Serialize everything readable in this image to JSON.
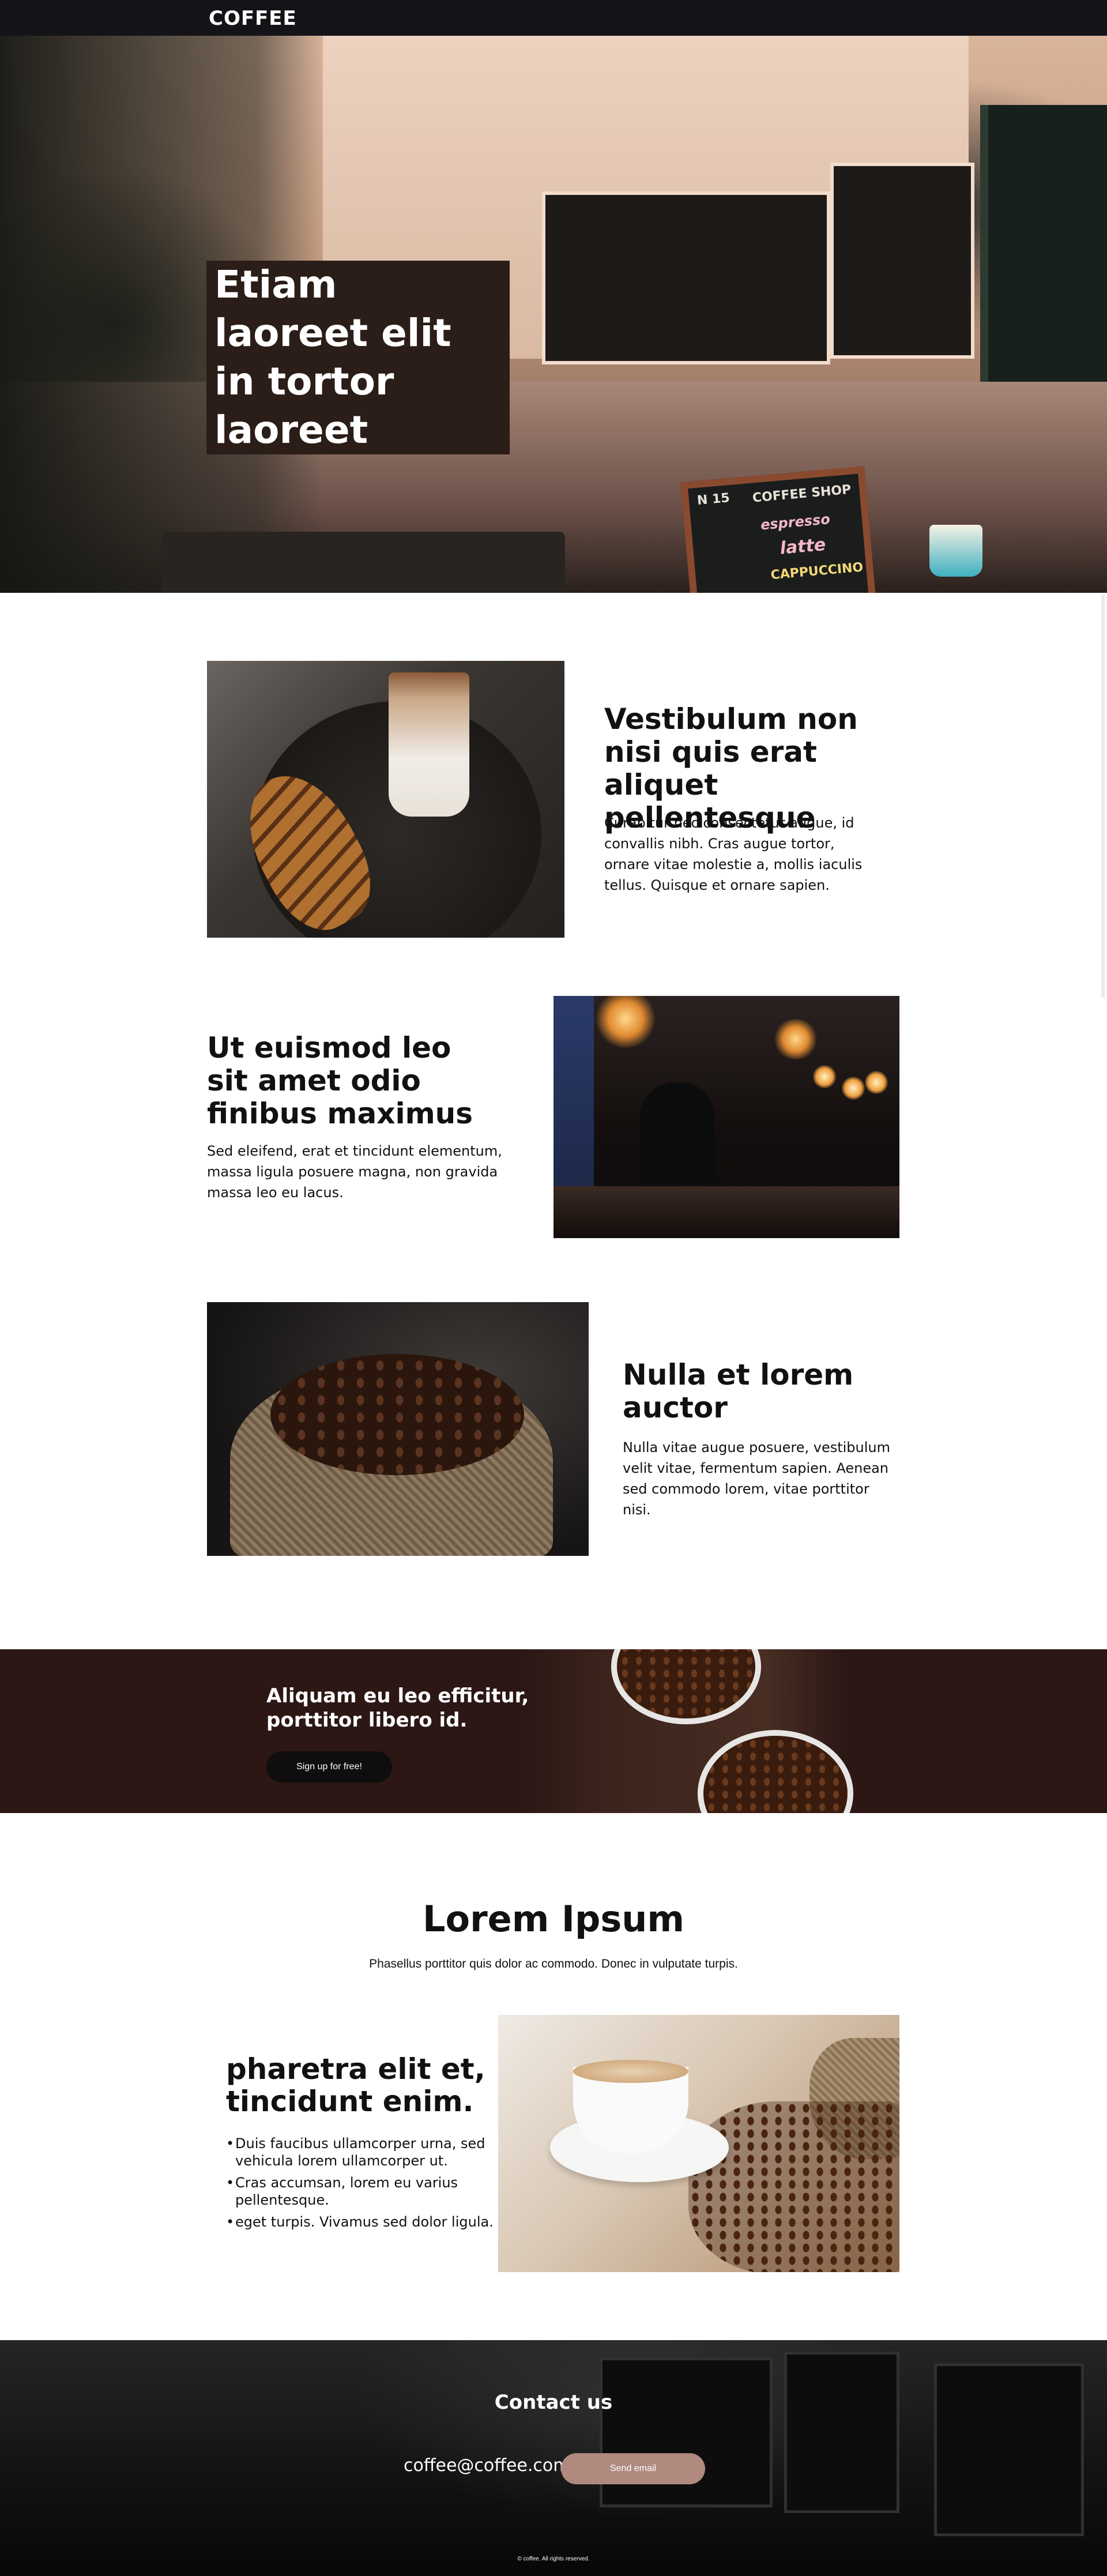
{
  "nav": {
    "brand": "COFFEE"
  },
  "hero": {
    "title_lines": [
      "Etiam laoreet elit",
      "in tortor laoreet"
    ],
    "sign": {
      "number": "N 15",
      "shop": "COFFEE SHOP",
      "items": [
        "espresso",
        "latte",
        "CAPPUCCINO"
      ]
    }
  },
  "features": [
    {
      "title": "Vestibulum non nisi quis erat aliquet pellentesque",
      "text": "Curabitur nec consectetur augue, id convallis nibh. Cras augue tortor, ornare vitae molestie a, mollis iaculis tellus. Quisque et ornare sapien.",
      "image_icon": "croissant-latte-image"
    },
    {
      "title": "Ut euismod leo sit amet odio finibus maximus",
      "text": "Sed eleifend, erat et tincidunt elementum, massa ligula posuere magna, non gravida massa leo eu lacus.",
      "image_icon": "coffee-bar-image"
    },
    {
      "title": "Nulla et lorem auctor",
      "text": "Nulla vitae augue posuere, vestibulum velit vitae, fermentum sapien. Aenean sed commodo lorem, vitae porttitor nisi.",
      "image_icon": "coffee-beans-sack-image"
    }
  ],
  "signup_band": {
    "title": "Aliquam eu leo efficitur, porttitor libero id.",
    "button_label": "Sign up for free!"
  },
  "lorem_section": {
    "title": "Lorem Ipsum",
    "subtitle": "Phasellus porttitor quis dolor ac commodo. Donec in vulputate turpis.",
    "subheading": "pharetra elit et, tincidunt enim.",
    "bullets": [
      "Duis faucibus ullamcorper urna, sed vehicula lorem ullamcorper ut.",
      "Cras accumsan, lorem eu varius pellentesque.",
      "eget turpis. Vivamus sed dolor ligula."
    ]
  },
  "contact": {
    "title": "Contact us",
    "email": "coffee@coffee.com",
    "button_label": "Send email",
    "copyright": "© coffee. All rights reserved."
  },
  "colors": {
    "nav_bg": "#141418",
    "hero_title_bg": "#2b1d17",
    "band_bg": "#2c1715",
    "signup_button": "#0f0d0e",
    "send_button": "#b08a7f"
  }
}
